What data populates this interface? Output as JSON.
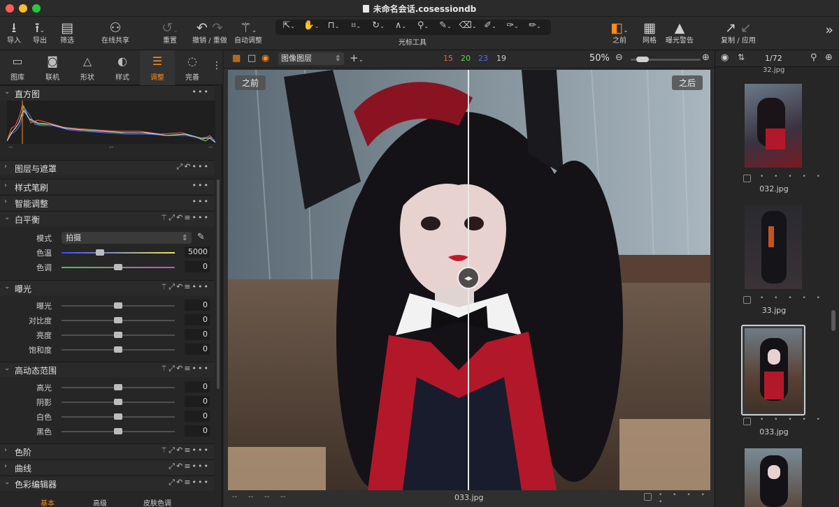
{
  "window": {
    "title": "未命名会话.cosessiondb"
  },
  "toolbar": {
    "import": "导入",
    "export": "导出",
    "filter": "筛选",
    "share": "在线共享",
    "reset": "重置",
    "undo_redo": "撤销 / 重做",
    "auto_adjust": "自动调整",
    "cursor_tools": "光标工具",
    "before": "之前",
    "grid": "网格",
    "exposure_warning": "曝光警告",
    "copy_apply": "复制 / 应用"
  },
  "tabs": [
    {
      "label": "图库"
    },
    {
      "label": "联机"
    },
    {
      "label": "形状"
    },
    {
      "label": "样式"
    },
    {
      "label": "调整"
    },
    {
      "label": "完善"
    }
  ],
  "histogram": {
    "title": "直方图",
    "left_value": "--",
    "mid_value": "--",
    "right_value": "--"
  },
  "sections": {
    "layers": "图层与遮罩",
    "brush": "样式笔刷",
    "smart": "智能调整",
    "white_balance": "白平衡",
    "exposure": "曝光",
    "hdr": "高动态范围",
    "levels": "色阶",
    "curves": "曲线",
    "color_editor": "色彩编辑器"
  },
  "white_balance": {
    "mode_label": "模式",
    "mode_value": "拍摄",
    "temp_label": "色温",
    "temp_value": "5000",
    "tint_label": "色调",
    "tint_value": "0"
  },
  "exposure": [
    {
      "label": "曝光",
      "value": "0"
    },
    {
      "label": "对比度",
      "value": "0"
    },
    {
      "label": "亮度",
      "value": "0"
    },
    {
      "label": "饱和度",
      "value": "0"
    }
  ],
  "hdr": [
    {
      "label": "高光",
      "value": "0"
    },
    {
      "label": "阴影",
      "value": "0"
    },
    {
      "label": "白色",
      "value": "0"
    },
    {
      "label": "黑色",
      "value": "0"
    }
  ],
  "color_editor_tabs": [
    "基本",
    "高级",
    "皮肤色调"
  ],
  "viewer": {
    "layer_select": "图像图层",
    "count_red": "15",
    "count_green": "20",
    "count_blue": "23",
    "count_total": "19",
    "zoom": "50%",
    "before_label": "之前",
    "after_label": "之后",
    "filename": "033.jpg",
    "meta": [
      "--",
      "--",
      "--",
      "--"
    ],
    "rating": "• • • • •"
  },
  "browser": {
    "counter": "1/72",
    "top_caption": "32.jpg",
    "items": [
      {
        "name": "032.jpg"
      },
      {
        "name": "33.jpg"
      },
      {
        "name": "033.jpg"
      }
    ],
    "rating": "• • • • •"
  },
  "colors": {
    "accent": "#ff8a1c",
    "red": "#ff5a4a",
    "green": "#62d24a",
    "blue": "#5a6cff"
  }
}
